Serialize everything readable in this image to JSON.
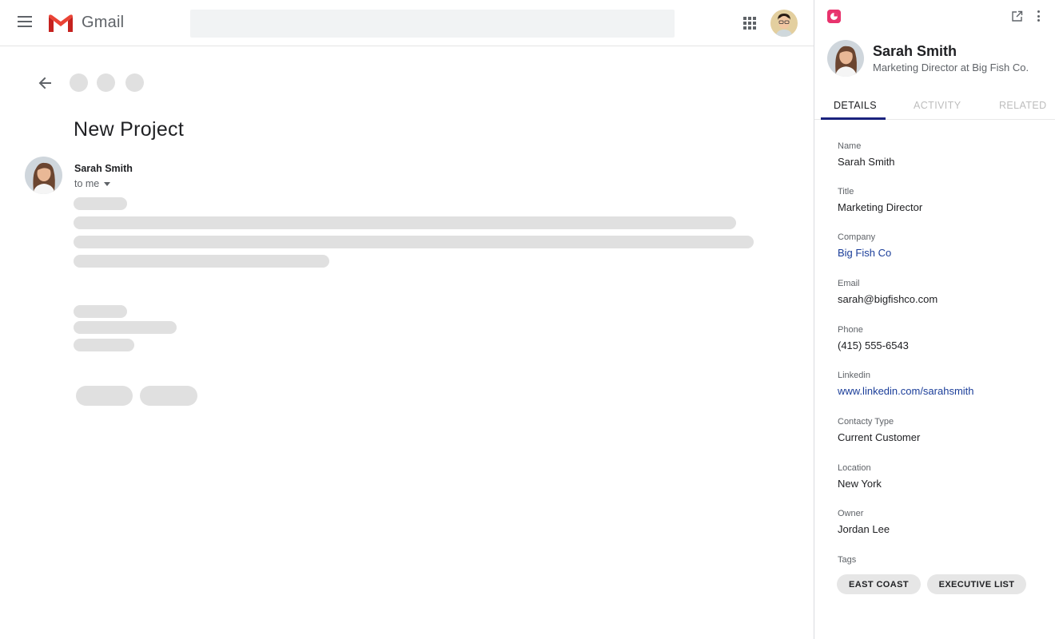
{
  "app": {
    "name": "Gmail"
  },
  "email": {
    "subject": "New Project",
    "sender": "Sarah Smith",
    "recipient": "to me"
  },
  "panel": {
    "contact": {
      "name": "Sarah Smith",
      "subtitle": "Marketing Director at Big Fish Co."
    },
    "tabs": [
      "DETAILS",
      "ACTIVITY",
      "RELATED"
    ],
    "active_tab": "DETAILS",
    "fields": [
      {
        "label": "Name",
        "value": "Sarah Smith",
        "link": false
      },
      {
        "label": "Title",
        "value": "Marketing Director",
        "link": false
      },
      {
        "label": "Company",
        "value": "Big Fish Co",
        "link": true
      },
      {
        "label": "Email",
        "value": "sarah@bigfishco.com",
        "link": false
      },
      {
        "label": "Phone",
        "value": "(415) 555-6543",
        "link": false
      },
      {
        "label": "Linkedin",
        "value": "www.linkedin.com/sarahsmith",
        "link": true
      },
      {
        "label": "Contacty Type",
        "value": "Current Customer",
        "link": false
      },
      {
        "label": "Location",
        "value": "New York",
        "link": false
      },
      {
        "label": "Owner",
        "value": "Jordan Lee",
        "link": false
      }
    ],
    "tags_label": "Tags",
    "tags": [
      "EAST COAST",
      "EXECUTIVE LIST"
    ]
  },
  "colors": {
    "brand": "#e8336d",
    "link": "#1a3d99",
    "tab_indicator": "#1a237e",
    "skeleton": "#e0e0e0"
  },
  "icons": [
    "menu-icon",
    "gmail-logo",
    "apps-icon",
    "back-arrow-icon",
    "open-in-new-icon",
    "more-vert-icon"
  ]
}
